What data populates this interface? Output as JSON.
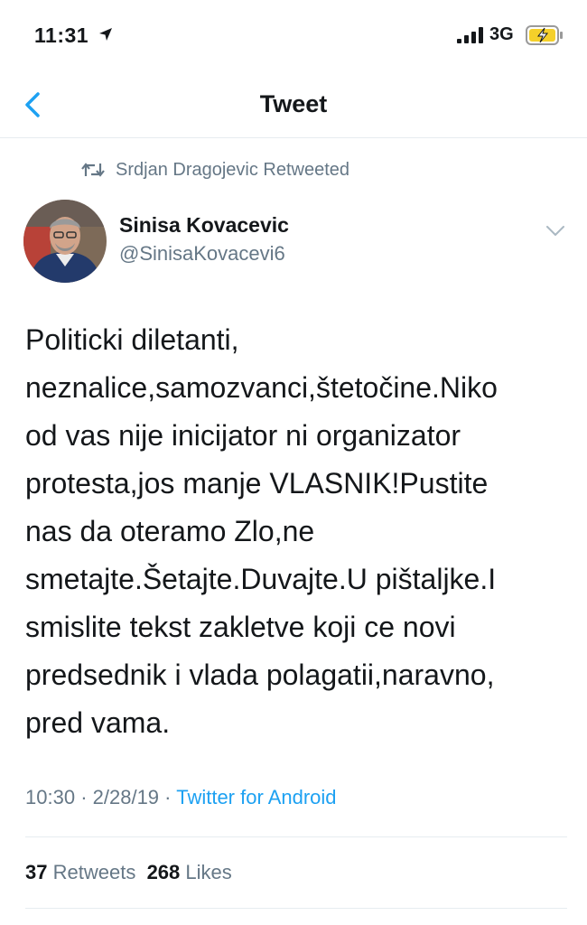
{
  "status_bar": {
    "time": "11:31",
    "network": "3G"
  },
  "header": {
    "title": "Tweet"
  },
  "retweet": {
    "text": "Srdjan Dragojevic Retweeted"
  },
  "author": {
    "name": "Sinisa Kovacevic",
    "handle": "@SinisaKovacevi6"
  },
  "tweet": {
    "text": "Politicki diletanti,\nneznalice,samozvanci,štetočine.Niko\nod vas nije inicijator ni organizator\nprotesta,jos manje VLASNIK!Pustite\nnas da oteramo Zlo,ne\nsmetajte.Šetajte.Duvajte.U pištaljke.I\nsmislite tekst zakletve koji ce novi\npredsednik i vlada polagatii,naravno,\npred vama.",
    "time": "10:30",
    "separator": "·",
    "date": "2/28/19",
    "source": "Twitter for Android"
  },
  "stats": {
    "retweets_count": "37",
    "retweets_label": "Retweets",
    "likes_count": "268",
    "likes_label": "Likes"
  },
  "colors": {
    "accent": "#1da1f2",
    "secondary_text": "#657786",
    "battery": "#f5d02a"
  },
  "icons": {
    "back": "chevron-left-icon",
    "retweet": "retweet-icon",
    "menu": "chevron-down-icon",
    "location": "location-arrow-icon"
  }
}
